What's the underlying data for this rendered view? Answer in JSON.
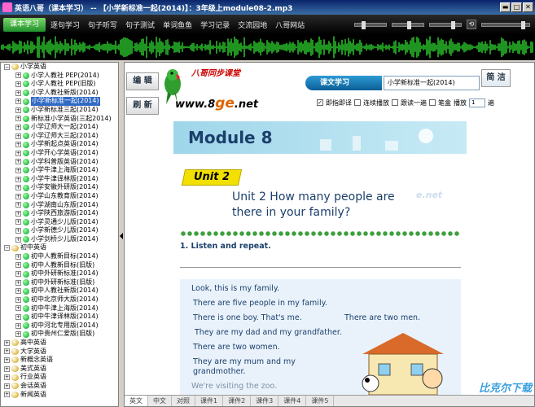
{
  "window": {
    "title": "英语八哥（课本学习） -- 【小学新标准一起(2014)】：3年级上module08-2.mp3",
    "buttons": [
      "▬",
      "□",
      "✕"
    ]
  },
  "menu": {
    "active": "课本学习",
    "items": [
      "逐句学习",
      "句子听写",
      "句子测试",
      "单词鱼鱼",
      "学习记录",
      "交流园地",
      "八哥网站"
    ]
  },
  "tree": {
    "groups": [
      {
        "label": "小学英语",
        "expanded": true,
        "items": [
          "小学人教社 PEP(2014)",
          "小学人教社 PEP(旧版)",
          "小学人教社新版(2014)",
          "小学新标准一起(2014)",
          "小学新标准三起(2014)",
          "新标准小学英语(三起2014)",
          "小学辽师大一起(2014)",
          "小学辽师大三起(2014)",
          "小学新起点英语(2014)",
          "小学开心学英语(2014)",
          "小学科普版英语(2014)",
          "小学牛津上海版(2014)",
          "小学牛津译林版(2014)",
          "小学安徽外研版(2014)",
          "小学山东教育版(2014)",
          "小学湖南山东版(2014)",
          "小学陕西旅游版(2014)",
          "小学灵通少儿版(2014)",
          "小学新德少儿版(2014)",
          "小学剑桥少儿版(2014)"
        ]
      },
      {
        "label": "初中英语",
        "expanded": true,
        "items": [
          "初中人教新目标(2014)",
          "初中人教新目标(旧版)",
          "初中外研新标准(2014)",
          "初中外研新标准(旧版)",
          "初中人教社新版(2014)",
          "初中北京师大版(2014)",
          "初中牛津上海版(2014)",
          "初中牛津译林版(2014)",
          "初中河北专用版(2014)",
          "初中贵州仁爱版(旧版)"
        ]
      },
      {
        "label": "高中英语",
        "expanded": false,
        "items": []
      },
      {
        "label": "大学英语",
        "expanded": false,
        "items": []
      },
      {
        "label": "新概念英语",
        "expanded": false,
        "items": []
      },
      {
        "label": "美式英语",
        "expanded": false,
        "items": []
      },
      {
        "label": "行业英语",
        "expanded": false,
        "items": []
      },
      {
        "label": "会话英语",
        "expanded": false,
        "items": []
      },
      {
        "label": "新闻英语",
        "expanded": false,
        "items": []
      }
    ],
    "selected": "小学新标准一起(2014)"
  },
  "header": {
    "edit_button": "编 辑",
    "refresh_button": "刷 新",
    "logo_arc": "八哥同步课堂",
    "logo_url_a": "www.8",
    "logo_url_g": "ge",
    "logo_url_b": ".net",
    "section_label": "课文学习",
    "book_select": "小学新标准一起(2014)",
    "simple_button": "简 洁",
    "opt_instant": "即指即译",
    "opt_continuous": "连续播放",
    "opt_follow": "跟读一遍",
    "opt_pen": "笔盒",
    "play_label": "播放",
    "play_count": "1",
    "play_unit": "遍"
  },
  "page": {
    "module": "Module 8",
    "unit": "Unit 2",
    "title_line1": "Unit 2 How many people are",
    "title_line2": "there in your family?",
    "watermark": "e.net",
    "section": "1. Listen and repeat.",
    "lines": [
      "Look, this is my family.",
      "There are five people in my family.",
      "There is one boy. That's me.",
      "There are two men.",
      "They are my dad and my grandfather.",
      "There are two women.",
      "They are my mum and my",
      "grandmother.",
      "We're visiting the zoo."
    ]
  },
  "bottom_tabs": [
    "英文",
    "中文",
    "对照",
    "课件1",
    "课件2",
    "课件3",
    "课件4",
    "课件5"
  ],
  "brand": "比克尔下载"
}
